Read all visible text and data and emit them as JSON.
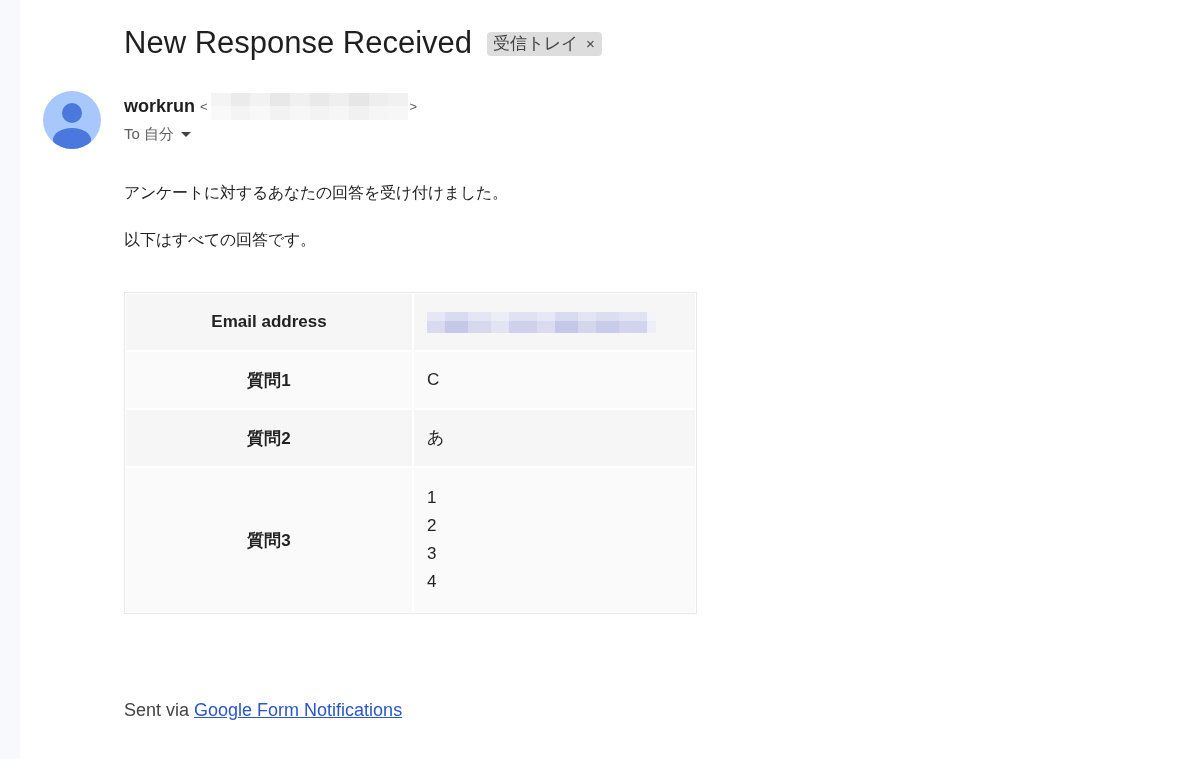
{
  "subject": "New Response Received",
  "labels": [
    {
      "text": "受信トレイ",
      "remove": "×"
    }
  ],
  "sender": {
    "name": "workrun",
    "open_bracket": "<",
    "close_bracket": ">"
  },
  "recipient": "To 自分",
  "body": [
    "アンケートに対するあなたの回答を受け付けました。",
    "以下はすべての回答です。"
  ],
  "responses": [
    {
      "kind": "redacted",
      "question": "Email address"
    },
    {
      "kind": "text",
      "question": "質問1",
      "answer": [
        "C"
      ]
    },
    {
      "kind": "text",
      "question": "質問2",
      "answer": [
        "あ"
      ]
    },
    {
      "kind": "text",
      "question": "質問3",
      "answer": [
        "1",
        "2",
        "3",
        "4"
      ]
    }
  ],
  "footer": {
    "text": "Sent via",
    "link": "Google Form Notifications"
  }
}
